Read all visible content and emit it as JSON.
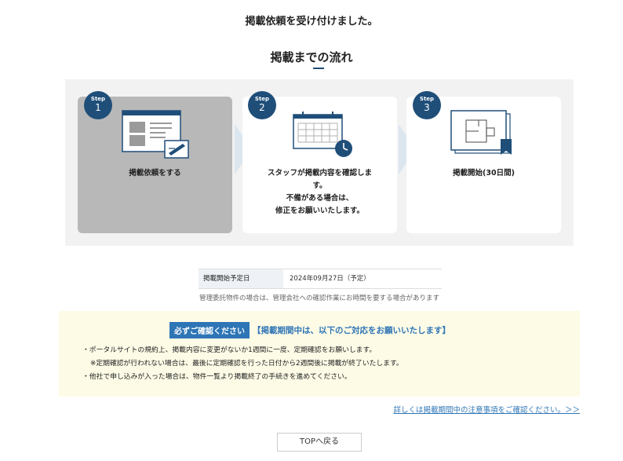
{
  "headline": "掲載依頼を受け付けました。",
  "flow": {
    "title": "掲載までの流れ",
    "step_label": "Step",
    "steps": [
      {
        "number": "1",
        "line1": "掲載依頼をする",
        "line2": "",
        "line3": "",
        "line4": ""
      },
      {
        "number": "2",
        "line1": "スタッフが掲載内容を確認しま",
        "line2": "す。",
        "line3": "不備がある場合は、",
        "line4": "修正をお願いいたします。"
      },
      {
        "number": "3",
        "line1": "掲載開始(30日間)",
        "line2": "",
        "line3": "",
        "line4": ""
      }
    ],
    "icons": [
      "document-form-icon",
      "calendar-clock-icon",
      "floorplan-bookmark-icon"
    ]
  },
  "info_table": {
    "label": "掲載開始予定日",
    "value": "2024年09月27日（予定）"
  },
  "note": "管理委託物件の場合は、管理会社への確認作業にお時間を要する場合があります",
  "notice": {
    "tag": "必ずご確認ください",
    "title": "【掲載期間中は、以下のご対応をお願いいたします】",
    "items": [
      "・ポータルサイトの規約上、掲載内容に変更がないか1週間に一度、定期確認をお願いします。",
      "※定期確認が行われない場合は、最後に定期確認を行った日付から2週間後に掲載が終了いたします。",
      "・他社で申し込みが入った場合は、物件一覧より掲載終了の手続きを進めてください。"
    ]
  },
  "detail_link": "詳しくは掲載期間中の注意事項をご確認ください。＞＞",
  "top_button": "TOPへ戻る",
  "colors": {
    "accent": "#1f4e79",
    "link": "#2e75b6",
    "notice_bg": "#fdfbe6",
    "active_step": "#b8b8b8"
  }
}
